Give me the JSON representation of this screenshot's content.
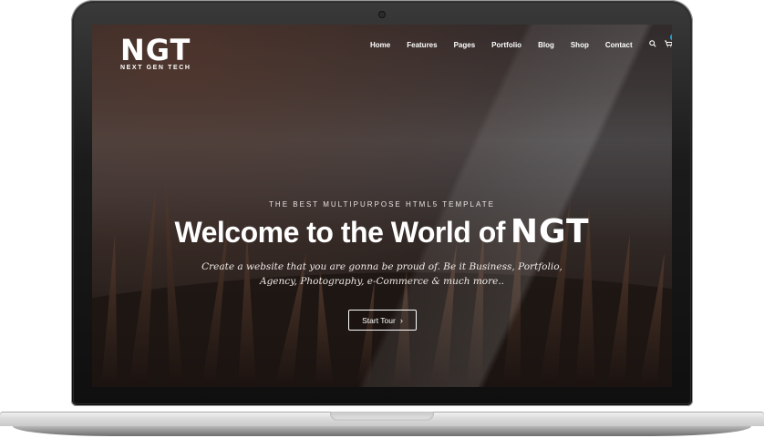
{
  "brand": {
    "logo_text": "NGT",
    "tagline": "NEXT GEN TECH"
  },
  "nav": {
    "items": [
      {
        "label": "Home"
      },
      {
        "label": "Features"
      },
      {
        "label": "Pages"
      },
      {
        "label": "Portfolio"
      },
      {
        "label": "Blog"
      },
      {
        "label": "Shop"
      },
      {
        "label": "Contact"
      }
    ],
    "search_icon": "search-icon",
    "cart_icon": "cart-icon",
    "cart_count": "5"
  },
  "hero": {
    "kicker": "THE BEST MULTIPURPOSE HTML5 TEMPLATE",
    "title": "Welcome to the World of",
    "title_brand": "NGT",
    "description_line1": "Create a website that you are gonna be proud of. Be it Business, Portfolio,",
    "description_line2": "Agency, Photography, e-Commerce & much more..",
    "cta_label": "Start Tour",
    "cta_icon": "chevron-right-icon"
  },
  "colors": {
    "accent": "#1fa1d6",
    "text": "#ffffff"
  }
}
